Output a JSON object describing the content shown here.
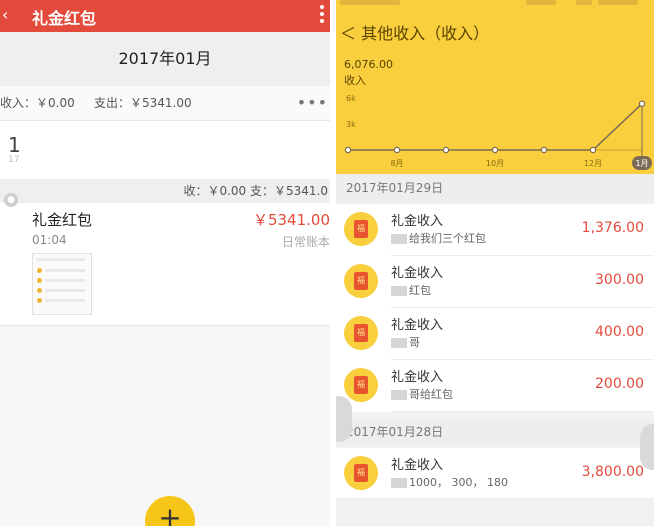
{
  "left": {
    "header": {
      "back": "‹",
      "title": "礼金红包"
    },
    "month": "2017年01月",
    "summary": {
      "income": "收入：￥0.00",
      "expense": "支出：￥5341.00",
      "more": "•••"
    },
    "day": {
      "number": "1",
      "sub": "17"
    },
    "day_summary": "收：￥0.00 支：￥5341.0",
    "entry": {
      "name": "礼金红包",
      "time": "01:04",
      "amount": "￥5341.00",
      "book": "日常账本"
    },
    "fab": "+"
  },
  "right": {
    "title": "＜ 其他收入（收入）",
    "value": "6,076.00",
    "value_label": "收入",
    "chart_data": {
      "type": "line",
      "categories": [
        "",
        "8月",
        "",
        "10月",
        "",
        "12月",
        "1月"
      ],
      "values": [
        0,
        0,
        0,
        0,
        0,
        0,
        5341
      ],
      "yticks": [
        "6k",
        "3k",
        "0"
      ],
      "ylim": [
        0,
        6000
      ]
    },
    "sections": [
      {
        "date": "2017年01月29日",
        "items": [
          {
            "title": "礼金收入",
            "note": "给我们三个红包",
            "amount": "1,376.00"
          },
          {
            "title": "礼金收入",
            "note": "红包",
            "amount": "300.00"
          },
          {
            "title": "礼金收入",
            "note": "哥",
            "amount": "400.00"
          },
          {
            "title": "礼金收入",
            "note": "哥给红包",
            "amount": "200.00"
          }
        ]
      },
      {
        "date": "2017年01月28日",
        "items": [
          {
            "title": "礼金收入",
            "note": "1000，    300，    180",
            "amount": "3,800.00"
          }
        ]
      }
    ],
    "icon_char": "福"
  }
}
